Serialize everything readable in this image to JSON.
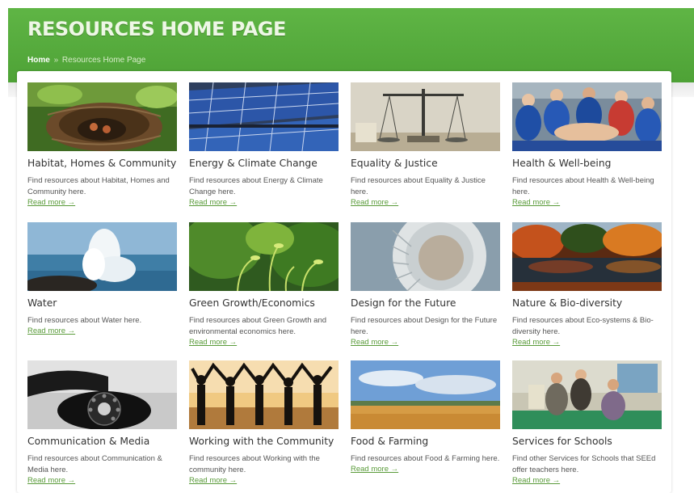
{
  "header": {
    "title": "RESOURCES HOME PAGE",
    "breadcrumb": {
      "home": "Home",
      "separator": "»",
      "current": "Resources Home Page"
    }
  },
  "read_more_label": "Read more →",
  "cards": [
    {
      "title": "Habitat, Homes & Community",
      "description": "Find resources about Habitat, Homes and Community here.",
      "image": "bird-nest-photo"
    },
    {
      "title": "Energy & Climate Change",
      "description": "Find resources about Energy & Climate Change here.",
      "image": "solar-panels-photo"
    },
    {
      "title": "Equality & Justice",
      "description": "Find resources about Equality & Justice here.",
      "image": "balance-scales-photo"
    },
    {
      "title": "Health & Well-being",
      "description": "Find resources about Health & Well-being here.",
      "image": "children-circle-photo"
    },
    {
      "title": "Water",
      "description": "Find resources about Water here.",
      "image": "wave-splash-photo"
    },
    {
      "title": "Green Growth/Economics",
      "description": "Find resources about Green Growth and environmental economics here.",
      "image": "green-sprouts-photo"
    },
    {
      "title": "Design for the Future",
      "description": "Find resources about Design for the Future here.",
      "image": "spiral-staircase-photo"
    },
    {
      "title": "Nature & Bio-diversity",
      "description": "Find resources about Eco-systems & Bio-diversity here.",
      "image": "autumn-lake-photo"
    },
    {
      "title": "Communication & Media",
      "description": "Find resources about Communication & Media here.",
      "image": "rotary-telephone-photo"
    },
    {
      "title": "Working with the Community",
      "description": "Find resources about Working with the community here.",
      "image": "raised-hands-silhouette-photo"
    },
    {
      "title": "Food & Farming",
      "description": "Find resources about Food & Farming here.",
      "image": "wheat-field-photo"
    },
    {
      "title": "Services for Schools",
      "description": "Find other Services for Schools that SEEd offer teachers here.",
      "image": "classroom-group-photo"
    }
  ]
}
